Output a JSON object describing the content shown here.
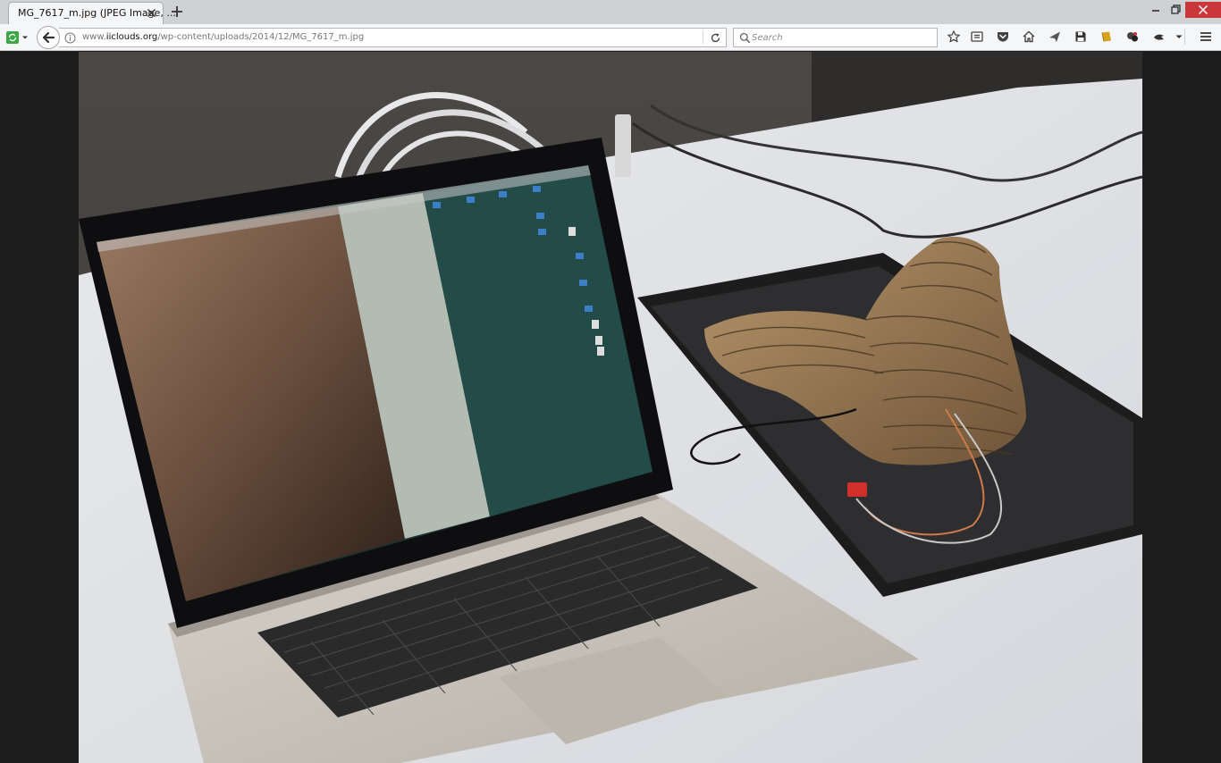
{
  "tab": {
    "title": "MG_7617_m.jpg (JPEG Image, ..."
  },
  "navbar": {
    "url_prefix": "www.",
    "url_domain": "iiclouds.org",
    "url_path": "/wp-content/uploads/2014/12/MG_7617_m.jpg",
    "search_placeholder": "Search"
  },
  "toolbar_icons": [
    "star-icon",
    "reading-list-icon",
    "pocket-icon",
    "home-icon",
    "send-icon",
    "save-icon",
    "bookmark-icon",
    "extension-icon",
    "extension2-icon",
    "dropdown-icon",
    "menu-icon"
  ],
  "colors": {
    "tab_strip": "#cfd1d5",
    "toolbar": "#f5f6f7",
    "close_button": "#c9373b",
    "viewer_background": "#1d1d1d"
  },
  "image": {
    "description_icon": "photo"
  }
}
